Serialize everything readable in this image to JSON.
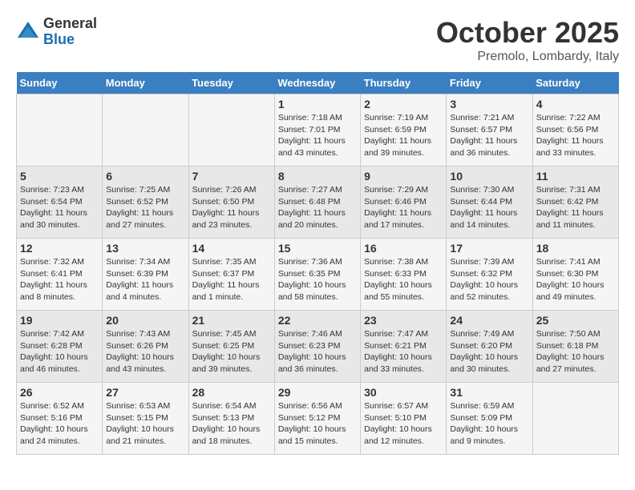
{
  "logo": {
    "general": "General",
    "blue": "Blue"
  },
  "header": {
    "month": "October 2025",
    "location": "Premolo, Lombardy, Italy"
  },
  "days_of_week": [
    "Sunday",
    "Monday",
    "Tuesday",
    "Wednesday",
    "Thursday",
    "Friday",
    "Saturday"
  ],
  "weeks": [
    [
      {
        "day": "",
        "info": ""
      },
      {
        "day": "",
        "info": ""
      },
      {
        "day": "",
        "info": ""
      },
      {
        "day": "1",
        "info": "Sunrise: 7:18 AM\nSunset: 7:01 PM\nDaylight: 11 hours and 43 minutes."
      },
      {
        "day": "2",
        "info": "Sunrise: 7:19 AM\nSunset: 6:59 PM\nDaylight: 11 hours and 39 minutes."
      },
      {
        "day": "3",
        "info": "Sunrise: 7:21 AM\nSunset: 6:57 PM\nDaylight: 11 hours and 36 minutes."
      },
      {
        "day": "4",
        "info": "Sunrise: 7:22 AM\nSunset: 6:56 PM\nDaylight: 11 hours and 33 minutes."
      }
    ],
    [
      {
        "day": "5",
        "info": "Sunrise: 7:23 AM\nSunset: 6:54 PM\nDaylight: 11 hours and 30 minutes."
      },
      {
        "day": "6",
        "info": "Sunrise: 7:25 AM\nSunset: 6:52 PM\nDaylight: 11 hours and 27 minutes."
      },
      {
        "day": "7",
        "info": "Sunrise: 7:26 AM\nSunset: 6:50 PM\nDaylight: 11 hours and 23 minutes."
      },
      {
        "day": "8",
        "info": "Sunrise: 7:27 AM\nSunset: 6:48 PM\nDaylight: 11 hours and 20 minutes."
      },
      {
        "day": "9",
        "info": "Sunrise: 7:29 AM\nSunset: 6:46 PM\nDaylight: 11 hours and 17 minutes."
      },
      {
        "day": "10",
        "info": "Sunrise: 7:30 AM\nSunset: 6:44 PM\nDaylight: 11 hours and 14 minutes."
      },
      {
        "day": "11",
        "info": "Sunrise: 7:31 AM\nSunset: 6:42 PM\nDaylight: 11 hours and 11 minutes."
      }
    ],
    [
      {
        "day": "12",
        "info": "Sunrise: 7:32 AM\nSunset: 6:41 PM\nDaylight: 11 hours and 8 minutes."
      },
      {
        "day": "13",
        "info": "Sunrise: 7:34 AM\nSunset: 6:39 PM\nDaylight: 11 hours and 4 minutes."
      },
      {
        "day": "14",
        "info": "Sunrise: 7:35 AM\nSunset: 6:37 PM\nDaylight: 11 hours and 1 minute."
      },
      {
        "day": "15",
        "info": "Sunrise: 7:36 AM\nSunset: 6:35 PM\nDaylight: 10 hours and 58 minutes."
      },
      {
        "day": "16",
        "info": "Sunrise: 7:38 AM\nSunset: 6:33 PM\nDaylight: 10 hours and 55 minutes."
      },
      {
        "day": "17",
        "info": "Sunrise: 7:39 AM\nSunset: 6:32 PM\nDaylight: 10 hours and 52 minutes."
      },
      {
        "day": "18",
        "info": "Sunrise: 7:41 AM\nSunset: 6:30 PM\nDaylight: 10 hours and 49 minutes."
      }
    ],
    [
      {
        "day": "19",
        "info": "Sunrise: 7:42 AM\nSunset: 6:28 PM\nDaylight: 10 hours and 46 minutes."
      },
      {
        "day": "20",
        "info": "Sunrise: 7:43 AM\nSunset: 6:26 PM\nDaylight: 10 hours and 43 minutes."
      },
      {
        "day": "21",
        "info": "Sunrise: 7:45 AM\nSunset: 6:25 PM\nDaylight: 10 hours and 39 minutes."
      },
      {
        "day": "22",
        "info": "Sunrise: 7:46 AM\nSunset: 6:23 PM\nDaylight: 10 hours and 36 minutes."
      },
      {
        "day": "23",
        "info": "Sunrise: 7:47 AM\nSunset: 6:21 PM\nDaylight: 10 hours and 33 minutes."
      },
      {
        "day": "24",
        "info": "Sunrise: 7:49 AM\nSunset: 6:20 PM\nDaylight: 10 hours and 30 minutes."
      },
      {
        "day": "25",
        "info": "Sunrise: 7:50 AM\nSunset: 6:18 PM\nDaylight: 10 hours and 27 minutes."
      }
    ],
    [
      {
        "day": "26",
        "info": "Sunrise: 6:52 AM\nSunset: 5:16 PM\nDaylight: 10 hours and 24 minutes."
      },
      {
        "day": "27",
        "info": "Sunrise: 6:53 AM\nSunset: 5:15 PM\nDaylight: 10 hours and 21 minutes."
      },
      {
        "day": "28",
        "info": "Sunrise: 6:54 AM\nSunset: 5:13 PM\nDaylight: 10 hours and 18 minutes."
      },
      {
        "day": "29",
        "info": "Sunrise: 6:56 AM\nSunset: 5:12 PM\nDaylight: 10 hours and 15 minutes."
      },
      {
        "day": "30",
        "info": "Sunrise: 6:57 AM\nSunset: 5:10 PM\nDaylight: 10 hours and 12 minutes."
      },
      {
        "day": "31",
        "info": "Sunrise: 6:59 AM\nSunset: 5:09 PM\nDaylight: 10 hours and 9 minutes."
      },
      {
        "day": "",
        "info": ""
      }
    ]
  ]
}
